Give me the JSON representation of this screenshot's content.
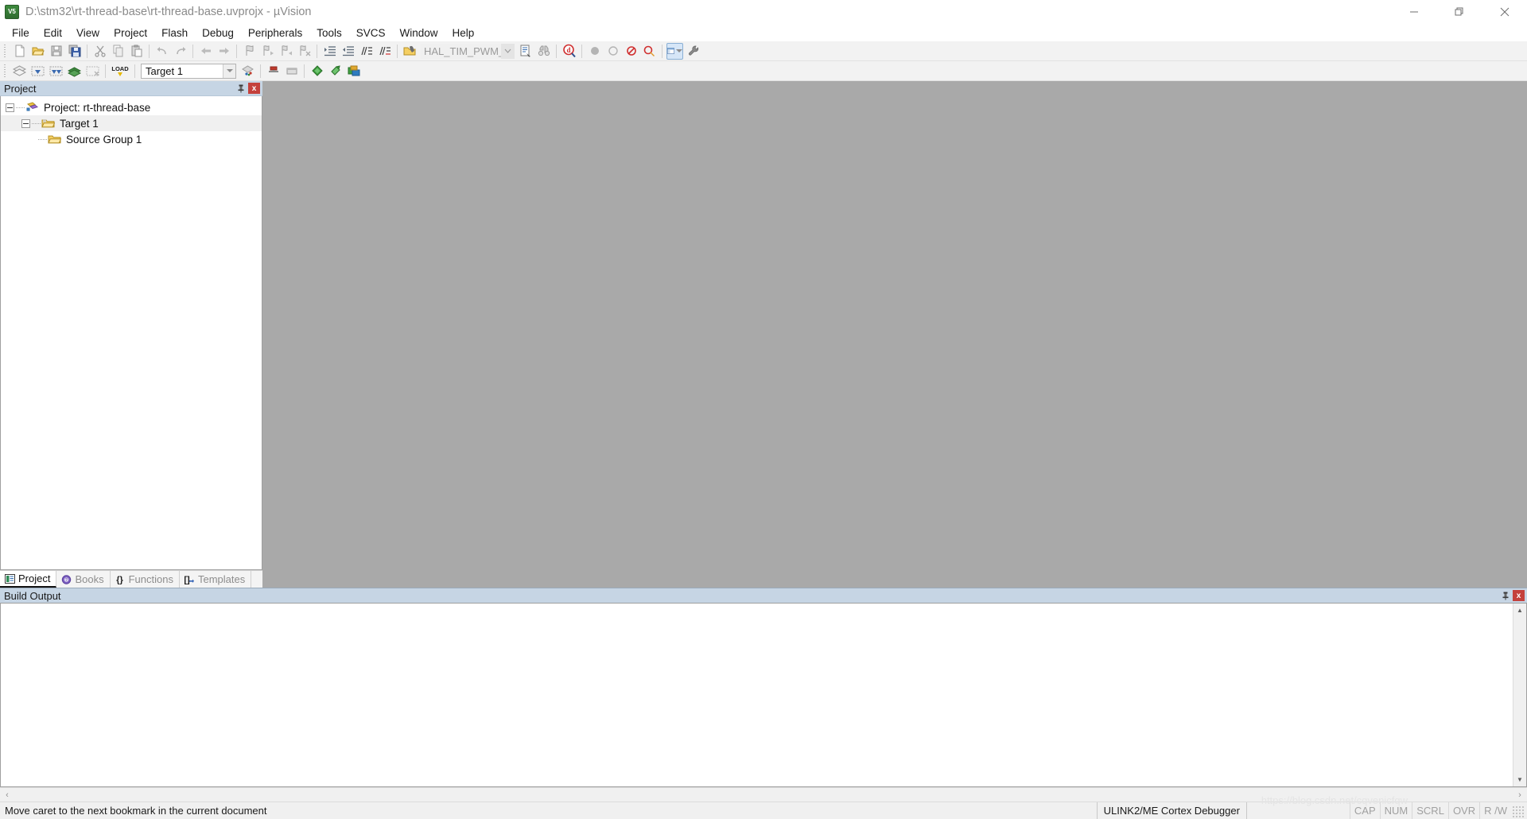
{
  "window": {
    "title": "D:\\stm32\\rt-thread-base\\rt-thread-base.uvprojx - µVision",
    "logo_text": "V5",
    "controls": {
      "minimize": "minimize-icon",
      "maximize": "restore-icon",
      "close": "close-icon"
    }
  },
  "menu": {
    "items": [
      {
        "label": "File"
      },
      {
        "label": "Edit"
      },
      {
        "label": "View"
      },
      {
        "label": "Project"
      },
      {
        "label": "Flash"
      },
      {
        "label": "Debug"
      },
      {
        "label": "Peripherals"
      },
      {
        "label": "Tools"
      },
      {
        "label": "SVCS"
      },
      {
        "label": "Window"
      },
      {
        "label": "Help"
      }
    ]
  },
  "toolbar_main": {
    "buttons": [
      {
        "name": "new-file-button",
        "icon": "new-file-icon",
        "tooltip": "New"
      },
      {
        "name": "open-file-button",
        "icon": "open-folder-icon",
        "tooltip": "Open"
      },
      {
        "name": "save-button",
        "icon": "save-disk-icon",
        "tooltip": "Save"
      },
      {
        "name": "save-all-button",
        "icon": "save-all-icon",
        "tooltip": "Save All"
      },
      {
        "name": "cut-button",
        "icon": "scissors-icon",
        "tooltip": "Cut"
      },
      {
        "name": "copy-button",
        "icon": "copy-icon",
        "tooltip": "Copy"
      },
      {
        "name": "paste-button",
        "icon": "paste-icon",
        "tooltip": "Paste"
      },
      {
        "name": "undo-button",
        "icon": "undo-arrow-icon",
        "tooltip": "Undo"
      },
      {
        "name": "redo-button",
        "icon": "redo-arrow-icon",
        "tooltip": "Redo"
      },
      {
        "name": "navigate-back-button",
        "icon": "arrow-left-icon",
        "tooltip": "Back"
      },
      {
        "name": "navigate-forward-button",
        "icon": "arrow-right-icon",
        "tooltip": "Forward"
      },
      {
        "name": "toggle-bookmark-button",
        "icon": "bookmark-icon",
        "tooltip": "Insert/Remove Bookmark"
      },
      {
        "name": "previous-bookmark-button",
        "icon": "bookmark-prev-icon",
        "tooltip": "Previous Bookmark"
      },
      {
        "name": "next-bookmark-button",
        "icon": "bookmark-next-icon",
        "tooltip": "Next Bookmark"
      },
      {
        "name": "clear-bookmarks-button",
        "icon": "bookmark-clear-icon",
        "tooltip": "Clear All Bookmarks"
      },
      {
        "name": "indent-right-button",
        "icon": "indent-right-icon",
        "tooltip": "Indent Selected Text"
      },
      {
        "name": "indent-left-button",
        "icon": "indent-left-icon",
        "tooltip": "Unindent Selected Text"
      },
      {
        "name": "comment-button",
        "icon": "comment-lines-icon",
        "tooltip": "Comment Selection"
      },
      {
        "name": "uncomment-button",
        "icon": "uncomment-lines-icon",
        "tooltip": "Uncomment Selection"
      },
      {
        "name": "open-file-under-cursor-button",
        "icon": "open-doc-hand-icon",
        "tooltip": "Open file under cursor"
      }
    ],
    "symbol_combo": {
      "name": "find-symbol-combo",
      "value": "HAL_TIM_PWM_Star",
      "placeholder": "HAL_TIM_PWM_Star"
    },
    "after_combo": [
      {
        "name": "browse-symbol-button",
        "icon": "browse-document-icon",
        "tooltip": "Browse Symbol"
      },
      {
        "name": "find-in-files-button",
        "icon": "binoculars-icon",
        "tooltip": "Find in Files"
      },
      {
        "name": "magnify-button",
        "icon": "magnifier-d-icon",
        "tooltip": "Start/Stop Debug Session"
      },
      {
        "name": "insert-breakpoint-button",
        "icon": "filled-circle-icon",
        "tooltip": "Insert/Remove Breakpoint"
      },
      {
        "name": "enable-breakpoint-button",
        "icon": "hollow-circle-icon",
        "tooltip": "Enable/Disable Breakpoint"
      },
      {
        "name": "disable-all-breakpoints-button",
        "icon": "circle-slash-icon",
        "tooltip": "Disable All Breakpoints"
      },
      {
        "name": "kill-all-breakpoints-button",
        "icon": "circle-kill-icon",
        "tooltip": "Kill All Breakpoints"
      }
    ],
    "window_combo": {
      "name": "window-layout-combo",
      "icon": "window-layout-icon",
      "active": true
    },
    "configure_button": {
      "name": "configure-button",
      "icon": "wrench-icon",
      "tooltip": "Configuration Wizard"
    }
  },
  "toolbar_build": {
    "buttons": [
      {
        "name": "translate-button",
        "icon": "translate-layers-icon",
        "tooltip": "Translate"
      },
      {
        "name": "build-button",
        "icon": "build-icon",
        "tooltip": "Build"
      },
      {
        "name": "rebuild-button",
        "icon": "rebuild-icon",
        "tooltip": "Rebuild"
      },
      {
        "name": "batch-build-button",
        "icon": "batch-build-icon",
        "tooltip": "Batch Build"
      },
      {
        "name": "stop-build-button",
        "icon": "stop-build-icon",
        "tooltip": "Stop Build"
      },
      {
        "name": "download-button",
        "icon": "load-icon",
        "tooltip": "Download",
        "label": "LOAD"
      }
    ],
    "target_combo": {
      "name": "select-target-combo",
      "value": "Target 1",
      "options": [
        "Target 1"
      ]
    },
    "after_target": [
      {
        "name": "target-options-button",
        "icon": "target-options-icon",
        "tooltip": "Options for Target"
      },
      {
        "name": "manage-project-items-button",
        "icon": "manage-components-icon",
        "tooltip": "Manage Project Items"
      },
      {
        "name": "pack-installer-button",
        "icon": "pack-installer-icon",
        "tooltip": "Pack Installer"
      },
      {
        "name": "manage-run-time-button",
        "icon": "green-diamond-icon",
        "tooltip": "Manage Run-Time Environment"
      },
      {
        "name": "select-software-packs-button",
        "icon": "green-arrow-icon",
        "tooltip": "Select Software Packs"
      },
      {
        "name": "svcs-button",
        "icon": "svcs-icon",
        "tooltip": "Software Version Control"
      }
    ]
  },
  "project_panel": {
    "title": "Project",
    "pin_icon": "pin-icon",
    "close_label": "x",
    "tree": [
      {
        "label": "Project: rt-thread-base",
        "level": 0,
        "icon": "project-icon",
        "expanded": true,
        "selected": false
      },
      {
        "label": "Target 1",
        "level": 1,
        "icon": "target-folder-icon",
        "expanded": true,
        "selected": true
      },
      {
        "label": "Source Group 1",
        "level": 2,
        "icon": "folder-icon",
        "expanded": false,
        "selected": false
      }
    ],
    "tabs": [
      {
        "label": "Project",
        "icon": "project-tab-icon",
        "selected": true
      },
      {
        "label": "Books",
        "icon": "books-tab-icon",
        "selected": false
      },
      {
        "label": "Functions",
        "icon": "functions-tab-icon",
        "selected": false
      },
      {
        "label": "Templates",
        "icon": "templates-tab-icon",
        "selected": false
      }
    ]
  },
  "build_output": {
    "title": "Build Output",
    "pin_icon": "pin-icon",
    "close_label": "x",
    "content": ""
  },
  "status_bar": {
    "message": "Move caret to the next bookmark in the current document",
    "debugger": "ULINK2/ME Cortex Debugger",
    "flags": [
      "CAP",
      "NUM",
      "SCRL",
      "OVR",
      "R /W"
    ]
  },
  "watermark": "https://blog.csdn.net/cqvenicfqw",
  "colors": {
    "pane_header": "#c6d5e4",
    "editor_background": "#a9a9a9",
    "close_red": "#c4413c",
    "title_text": "#8a8a8a"
  }
}
